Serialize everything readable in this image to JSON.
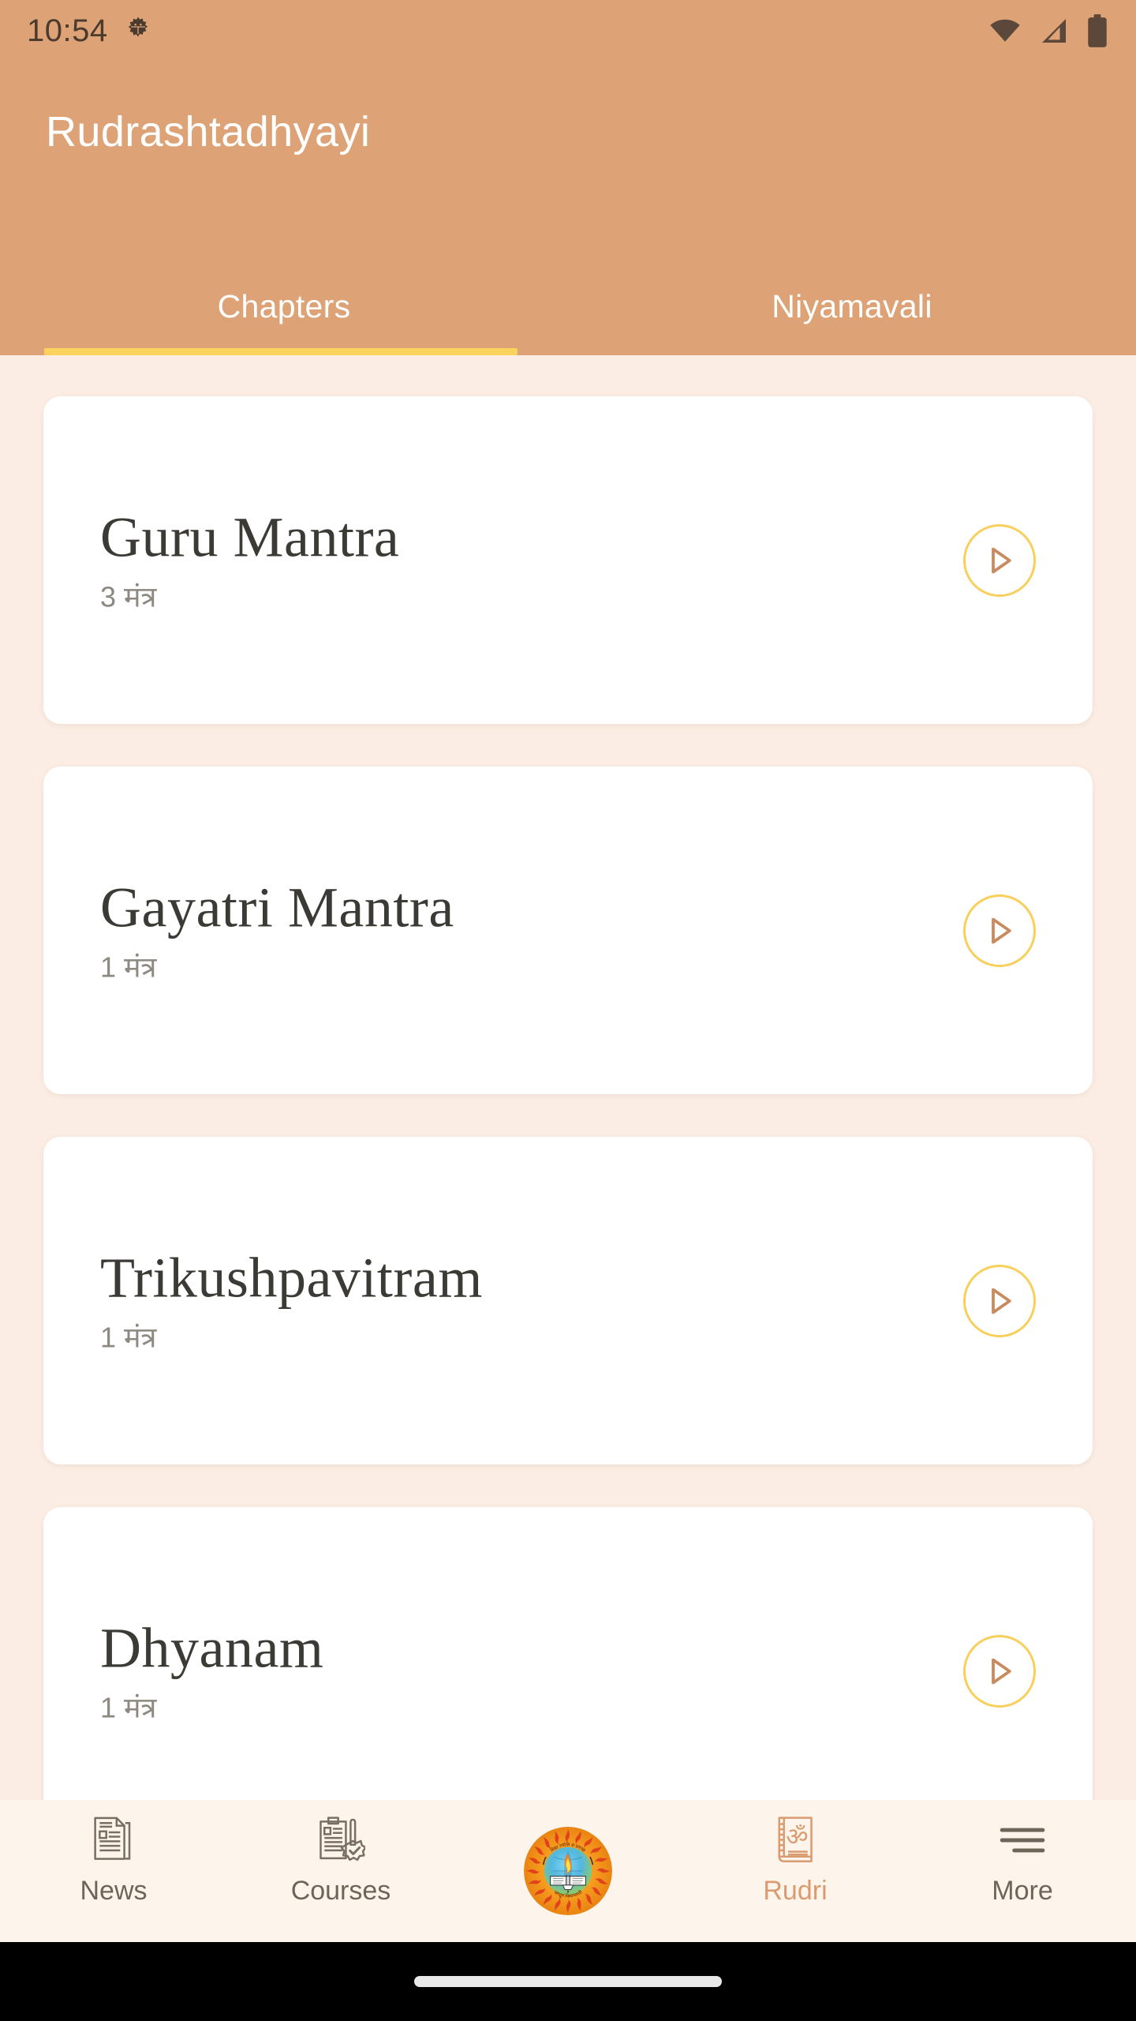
{
  "status_bar": {
    "time": "10:54",
    "icons": [
      "gear-icon",
      "wifi-icon",
      "cellular-signal-icon",
      "battery-icon"
    ],
    "text_color": "#4A3B2E"
  },
  "app_bar": {
    "title": "Rudrashtadhyayi",
    "background": "#DDA377",
    "title_color": "#FFFFFF"
  },
  "tabs": {
    "active_index": 0,
    "indicator_color": "#FBD25E",
    "items": [
      {
        "label": "Chapters"
      },
      {
        "label": "Niyamavali"
      }
    ]
  },
  "content": {
    "background": "#FBEDE3",
    "card_background": "#FFFFFF",
    "title_color": "#3C3A34",
    "subtitle_color": "#8D8880",
    "play_ring_color": "#F9CF5B",
    "play_triangle_color": "#C98A5E",
    "chapters": [
      {
        "title": "Guru Mantra",
        "count": "3 मंत्र",
        "play": "play-icon"
      },
      {
        "title": "Gayatri Mantra",
        "count": "1 मंत्र",
        "play": "play-icon"
      },
      {
        "title": "Trikushpavitram",
        "count": "1 मंत्र",
        "play": "play-icon"
      },
      {
        "title": "Dhyanam",
        "count": "1 मंत्र",
        "play": "play-icon"
      }
    ]
  },
  "bottom_nav": {
    "background": "#FDF5EC",
    "active_color": "#DA9B70",
    "inactive_color": "#6E6458",
    "active_index": 3,
    "items": [
      {
        "label": "News",
        "icon": "news-document-icon"
      },
      {
        "label": "Courses",
        "icon": "clipboard-check-icon"
      },
      {
        "label": "",
        "icon": "app-logo-icon"
      },
      {
        "label": "Rudri",
        "icon": "om-book-icon"
      },
      {
        "label": "More",
        "icon": "hamburger-menu-icon"
      }
    ]
  }
}
